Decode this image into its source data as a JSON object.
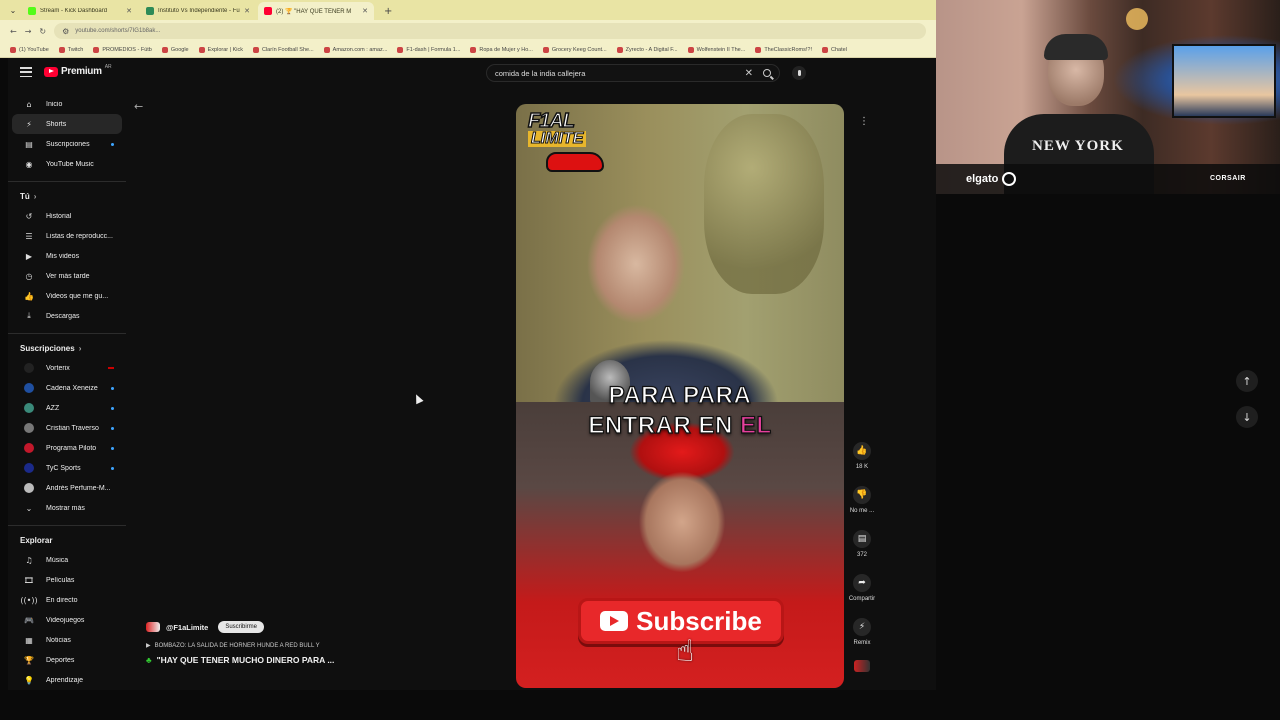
{
  "browser": {
    "tabs": [
      {
        "title": "Stream - Kick Dashboard",
        "color": "#53fc18",
        "active": false
      },
      {
        "title": "Instituto Vs Independiente - Fu",
        "color": "#2e8b57",
        "active": false
      },
      {
        "title": "(2) 🏆 \"HAY QUE TENER M",
        "color": "#ff0033",
        "active": true
      }
    ],
    "url": "youtube.com/shorts/7IG1b8ak...",
    "bookmarks": [
      "(1) YouTube",
      "Twitch",
      "PROMEDIOS - Fútb",
      "Google",
      "Explorar | Kick",
      "Clarín Football She...",
      "Amazon.com : amaz...",
      "F1-dash | Formula 1...",
      "Ropa de Mujer y Ho...",
      "Grocery Keeg Count...",
      "Zyrecto - A Digital F...",
      "Wolfenstein II The...",
      "TheClassicRoms!?!",
      "Chatel"
    ]
  },
  "header": {
    "logo_text": "Premium",
    "country": "AR",
    "search_query": "comida de la india callejera"
  },
  "sidebar": {
    "main": [
      {
        "label": "Inicio",
        "icon": "⌂",
        "active": false
      },
      {
        "label": "Shorts",
        "icon": "⚡",
        "active": true
      },
      {
        "label": "Suscripciones",
        "icon": "▤",
        "active": false,
        "dot": true
      },
      {
        "label": "YouTube Music",
        "icon": "◉",
        "active": false
      }
    ],
    "you_heading": "Tú",
    "you": [
      {
        "label": "Historial",
        "icon": "↺"
      },
      {
        "label": "Listas de reproducc...",
        "icon": "☰"
      },
      {
        "label": "Mis videos",
        "icon": "▶"
      },
      {
        "label": "Ver más tarde",
        "icon": "◷"
      },
      {
        "label": "Videos que me gu...",
        "icon": "👍"
      },
      {
        "label": "Descargas",
        "icon": "⤓"
      }
    ],
    "subs_heading": "Suscripciones",
    "subs": [
      {
        "label": "Vorterix",
        "color": "#222",
        "live": true
      },
      {
        "label": "Cadena Xeneize",
        "color": "#1f4fa0",
        "dot": true
      },
      {
        "label": "AZZ",
        "color": "#3a8a7a",
        "dot": true
      },
      {
        "label": "Cristian Traverso",
        "color": "#777",
        "dot": true
      },
      {
        "label": "Programa Piloto",
        "color": "#c2182b",
        "dot": true
      },
      {
        "label": "TyC Sports",
        "color": "#1b2a8a",
        "dot": true
      },
      {
        "label": "Andrés Perfume-M...",
        "color": "#bbb",
        "dot": false
      }
    ],
    "show_more": "Mostrar más",
    "explore_heading": "Explorar",
    "explore": [
      {
        "label": "Música",
        "icon": "♫"
      },
      {
        "label": "Películas",
        "icon": "🎞"
      },
      {
        "label": "En directo",
        "icon": "((•))"
      },
      {
        "label": "Videojuegos",
        "icon": "🎮"
      },
      {
        "label": "Noticias",
        "icon": "▦"
      },
      {
        "label": "Deportes",
        "icon": "🏆"
      },
      {
        "label": "Aprendizaje",
        "icon": "💡"
      }
    ]
  },
  "short": {
    "logo_line1": "F1AL",
    "logo_line2": "LIMITE",
    "caption_line1": "PARA PARA",
    "caption_line2_a": "ENTRAR EN ",
    "caption_line2_b": "EL",
    "subscribe_text": "Subscribe",
    "likes": "18 K",
    "dislike_label": "No me ...",
    "comments": "372",
    "share_label": "Compartir",
    "remix_label": "Remix",
    "channel": "@F1aLimite",
    "subscribe_pill": "Suscribirme",
    "song": "BOMBAZO: LA SALIDA DE HORNER HUNDE A RED BULL Y",
    "title": "\"HAY QUE TENER MUCHO DINERO PARA ..."
  },
  "webcam": {
    "shirt_text": "NEW YORK",
    "brand_left": "elgato",
    "brand_right": "CORSAIR"
  }
}
